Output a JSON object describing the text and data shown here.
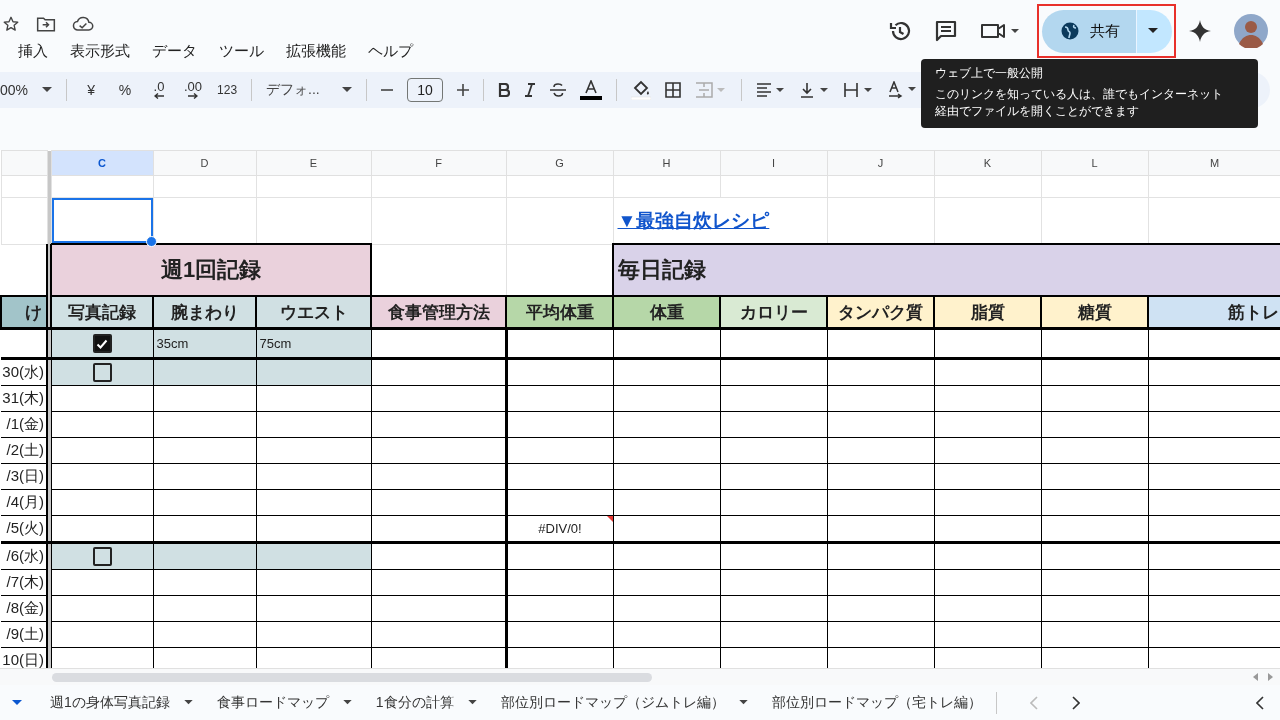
{
  "menu": [
    "挿入",
    "表示形式",
    "データ",
    "ツール",
    "拡張機能",
    "ヘルプ"
  ],
  "share": {
    "label": "共有"
  },
  "tooltip": {
    "title": "ウェブ上で一般公開",
    "body": "このリンクを知っている人は、誰でもインターネット経由でファイルを開くことができます"
  },
  "toolbar": {
    "zoom": "00%",
    "currency": "¥",
    "percent": "%",
    "decrease_decimals": ".0",
    "increase_decimals": ".00",
    "number_format": "123",
    "font": "デフォ...",
    "font_size": "10"
  },
  "sheet": {
    "columns": [
      {
        "letter": "C",
        "selected": true
      },
      {
        "letter": "D",
        "selected": false
      },
      {
        "letter": "E",
        "selected": false
      },
      {
        "letter": "F",
        "selected": false
      },
      {
        "letter": "G",
        "selected": false
      },
      {
        "letter": "H",
        "selected": false
      },
      {
        "letter": "I",
        "selected": false
      },
      {
        "letter": "J",
        "selected": false
      },
      {
        "letter": "K",
        "selected": false
      },
      {
        "letter": "L",
        "selected": false
      },
      {
        "letter": "M",
        "selected": false
      }
    ],
    "link": "▼最強自炊レシピ",
    "sections": [
      {
        "label": "週1回記録",
        "color": "#ead1dc"
      },
      {
        "label": "毎日記録",
        "color": "#d9d2e9"
      }
    ],
    "headers": [
      {
        "label": "け",
        "color": "#a2c4c9"
      },
      {
        "label": "写真記録",
        "color": "#d0e0e3"
      },
      {
        "label": "腕まわり",
        "color": "#d0e0e3"
      },
      {
        "label": "ウエスト",
        "color": "#d0e0e3"
      },
      {
        "label": "食事管理方法",
        "color": "#ead1dc"
      },
      {
        "label": "平均体重",
        "color": "#b6d7a8"
      },
      {
        "label": "体重",
        "color": "#b6d7a8"
      },
      {
        "label": "カロリー",
        "color": "#d9ead3"
      },
      {
        "label": "タンパク質",
        "color": "#fff2cc"
      },
      {
        "label": "脂質",
        "color": "#fff2cc"
      },
      {
        "label": "糖質",
        "color": "#fff2cc"
      },
      {
        "label": "筋トレ",
        "color": "#cfe2f3"
      }
    ],
    "rows": [
      {
        "kind": "weekly",
        "checked": true,
        "arm": "35cm",
        "waist": "75cm"
      },
      {
        "date": "30(水)",
        "kind": "weekly",
        "checked": false
      },
      {
        "date": "31(木)",
        "kind": "daily"
      },
      {
        "date": "/1(金)",
        "kind": "daily"
      },
      {
        "date": "/2(土)",
        "kind": "daily"
      },
      {
        "date": "/3(日)",
        "kind": "daily"
      },
      {
        "date": "/4(月)",
        "kind": "daily"
      },
      {
        "date": "/5(火)",
        "kind": "daily",
        "average": "#DIV/0!",
        "error": true
      },
      {
        "date": "/6(水)",
        "kind": "weekly",
        "checked": false
      },
      {
        "date": "/7(木)",
        "kind": "daily"
      },
      {
        "date": "/8(金)",
        "kind": "daily"
      },
      {
        "date": "/9(土)",
        "kind": "daily"
      },
      {
        "date": "10(日)",
        "kind": "daily"
      }
    ]
  },
  "tabs": [
    {
      "label": "週1の身体写真記録",
      "selected": false,
      "menu": true
    },
    {
      "label": "食事ロードマップ",
      "selected": false,
      "menu": true
    },
    {
      "label": "1食分の計算",
      "selected": false,
      "menu": true
    },
    {
      "label": "部位別ロードマップ（ジムトレ編）",
      "selected": false,
      "menu": true
    },
    {
      "label": "部位別ロードマップ（宅トレ編）",
      "selected": false,
      "menu": false
    }
  ]
}
